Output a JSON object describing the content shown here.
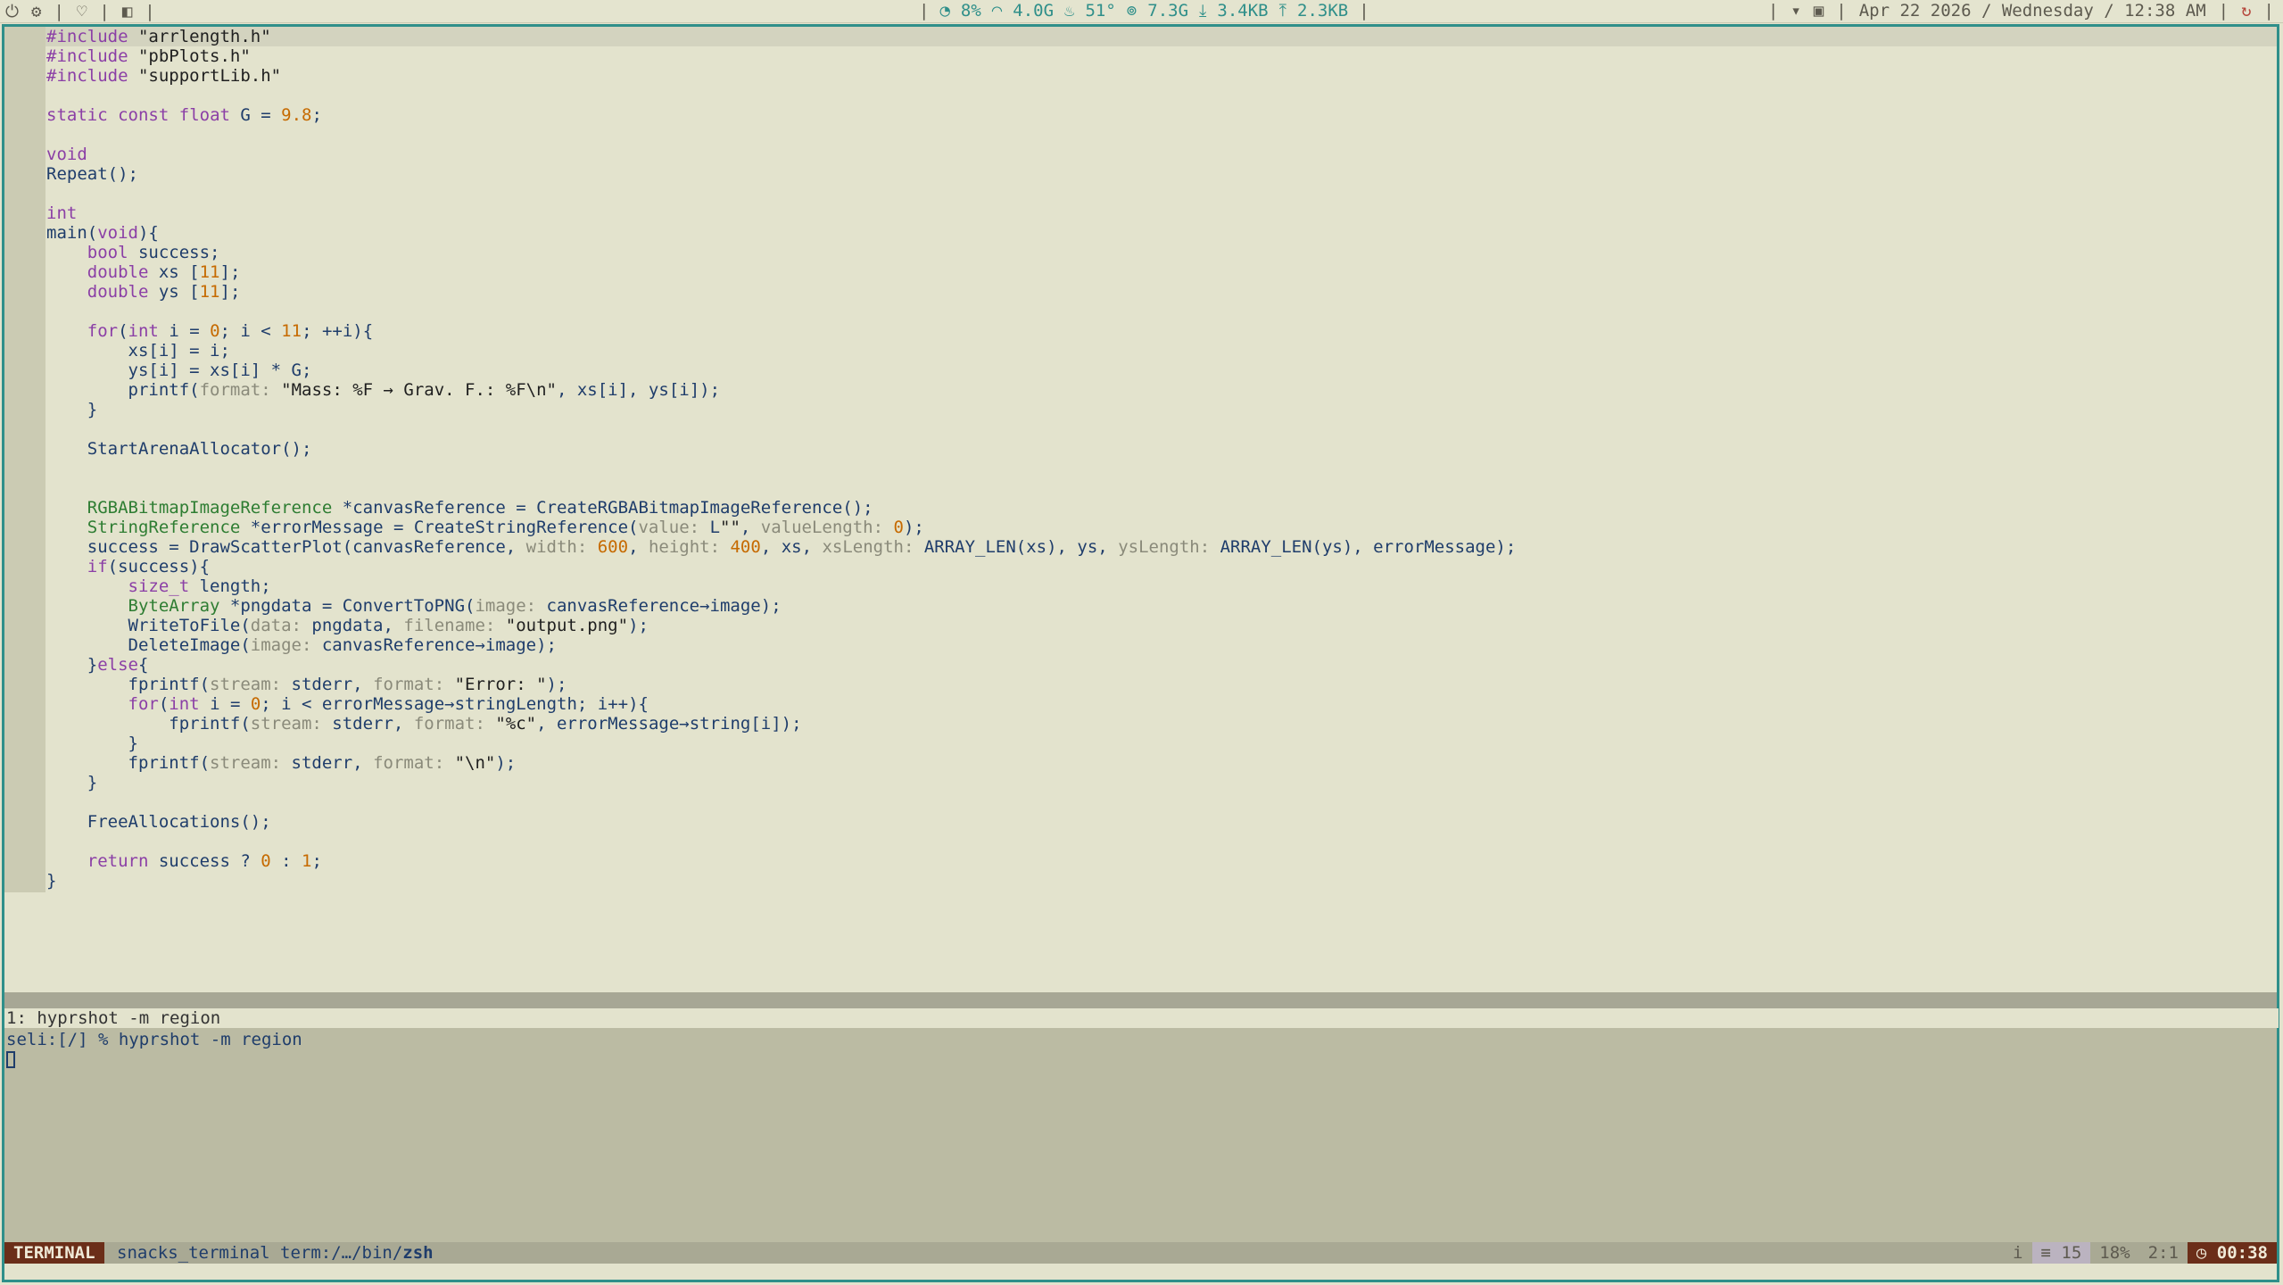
{
  "topbar": {
    "left_icons": [
      "power-icon",
      "settings-icon",
      "shield-icon",
      "window-icon"
    ],
    "stats": {
      "cpu": "8%",
      "mem": "4.0G",
      "temp": "51°",
      "disk": "7.3G",
      "down": "3.4KB",
      "up": "2.3KB"
    },
    "date": "Apr 22 2026 / Wednesday / 12:38 AM"
  },
  "editor": {
    "lines": [
      "#include \"arrlength.h\"",
      "#include \"pbPlots.h\"",
      "#include \"supportLib.h\"",
      "",
      "static const float G = 9.8;",
      "",
      "void",
      "Repeat();",
      "",
      "int",
      "main(void){",
      "    bool success;",
      "    double xs [11];",
      "    double ys [11];",
      "",
      "    for(int i = 0; i < 11; ++i){",
      "        xs[i] = i;",
      "        ys[i] = xs[i] * G;",
      "        printf(format: \"Mass: %F → Grav. F.: %F\\n\", xs[i], ys[i]);",
      "    }",
      "",
      "    StartArenaAllocator();",
      "",
      "",
      "    RGBABitmapImageReference *canvasReference = CreateRGBABitmapImageReference();",
      "    StringReference *errorMessage = CreateStringReference(value: L\"\", valueLength: 0);",
      "    success = DrawScatterPlot(canvasReference, width: 600, height: 400, xs, xsLength: ARRAY_LEN(xs), ys, ysLength: ARRAY_LEN(ys), errorMessage);",
      "    if(success){",
      "        size_t length;",
      "        ByteArray *pngdata = ConvertToPNG(image: canvasReference→image);",
      "        WriteToFile(data: pngdata, filename: \"output.png\");",
      "        DeleteImage(image: canvasReference→image);",
      "    }else{",
      "        fprintf(stream: stderr, format: \"Error: \");",
      "        for(int i = 0; i < errorMessage→stringLength; i++){",
      "            fprintf(stream: stderr, format: \"%c\", errorMessage→string[i]);",
      "        }",
      "        fprintf(stream: stderr, format: \"\\n\");",
      "    }",
      "",
      "    FreeAllocations();",
      "",
      "    return success ? 0 : 1;",
      "}"
    ]
  },
  "terminal": {
    "title": "1: hyprshot -m region",
    "prompt_line": "seli:[/] % hyprshot -m region"
  },
  "statusline": {
    "mode": "TERMINAL",
    "buffer": "snacks_terminal term:/…/bin/",
    "buffer_bold": "zsh",
    "insert": "i",
    "count": "≡ 15",
    "percent": "18%",
    "position": "2:1",
    "time": "◷ 00:38"
  }
}
